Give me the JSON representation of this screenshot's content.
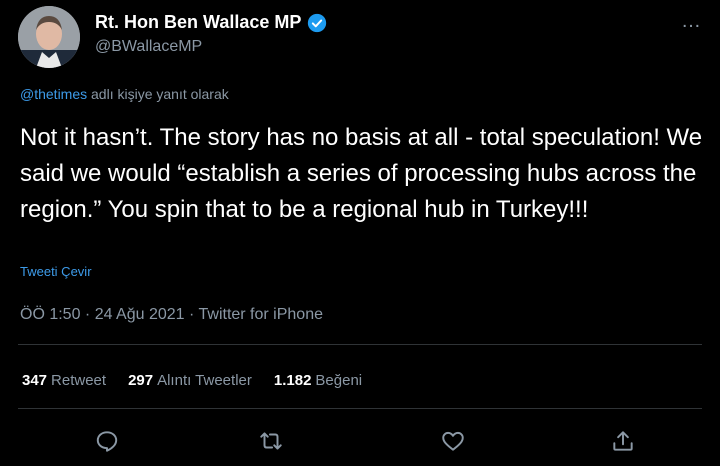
{
  "user": {
    "display_name": "Rt. Hon Ben Wallace MP",
    "handle": "@BWallaceMP",
    "verified": true
  },
  "more_icon": "…",
  "reply": {
    "mention": "@thetimes",
    "suffix": " adlı kişiye yanıt olarak"
  },
  "text": "Not it hasn’t. The story has no basis at all - total speculation! We said we would “establish a series of processing hubs across the region.” You spin that to be a regional hub in Turkey!!!",
  "translate_label": "Tweeti Çevir",
  "meta": "ÖÖ 1:50 · 24 Ağu 2021 · Twitter for iPhone",
  "stats": [
    {
      "count": "347",
      "label": "Retweet"
    },
    {
      "count": "297",
      "label": "Alıntı Tweetler"
    },
    {
      "count": "1.182",
      "label": "Beğeni"
    }
  ],
  "actions": [
    {
      "icon": "reply-icon"
    },
    {
      "icon": "retweet-icon"
    },
    {
      "icon": "like-icon"
    },
    {
      "icon": "share-icon"
    }
  ],
  "colors": {
    "background": "#000000",
    "text": "#ffffff",
    "secondary": "#8b98a5",
    "link": "#3d9be9",
    "verified": "#1d9bf0"
  }
}
